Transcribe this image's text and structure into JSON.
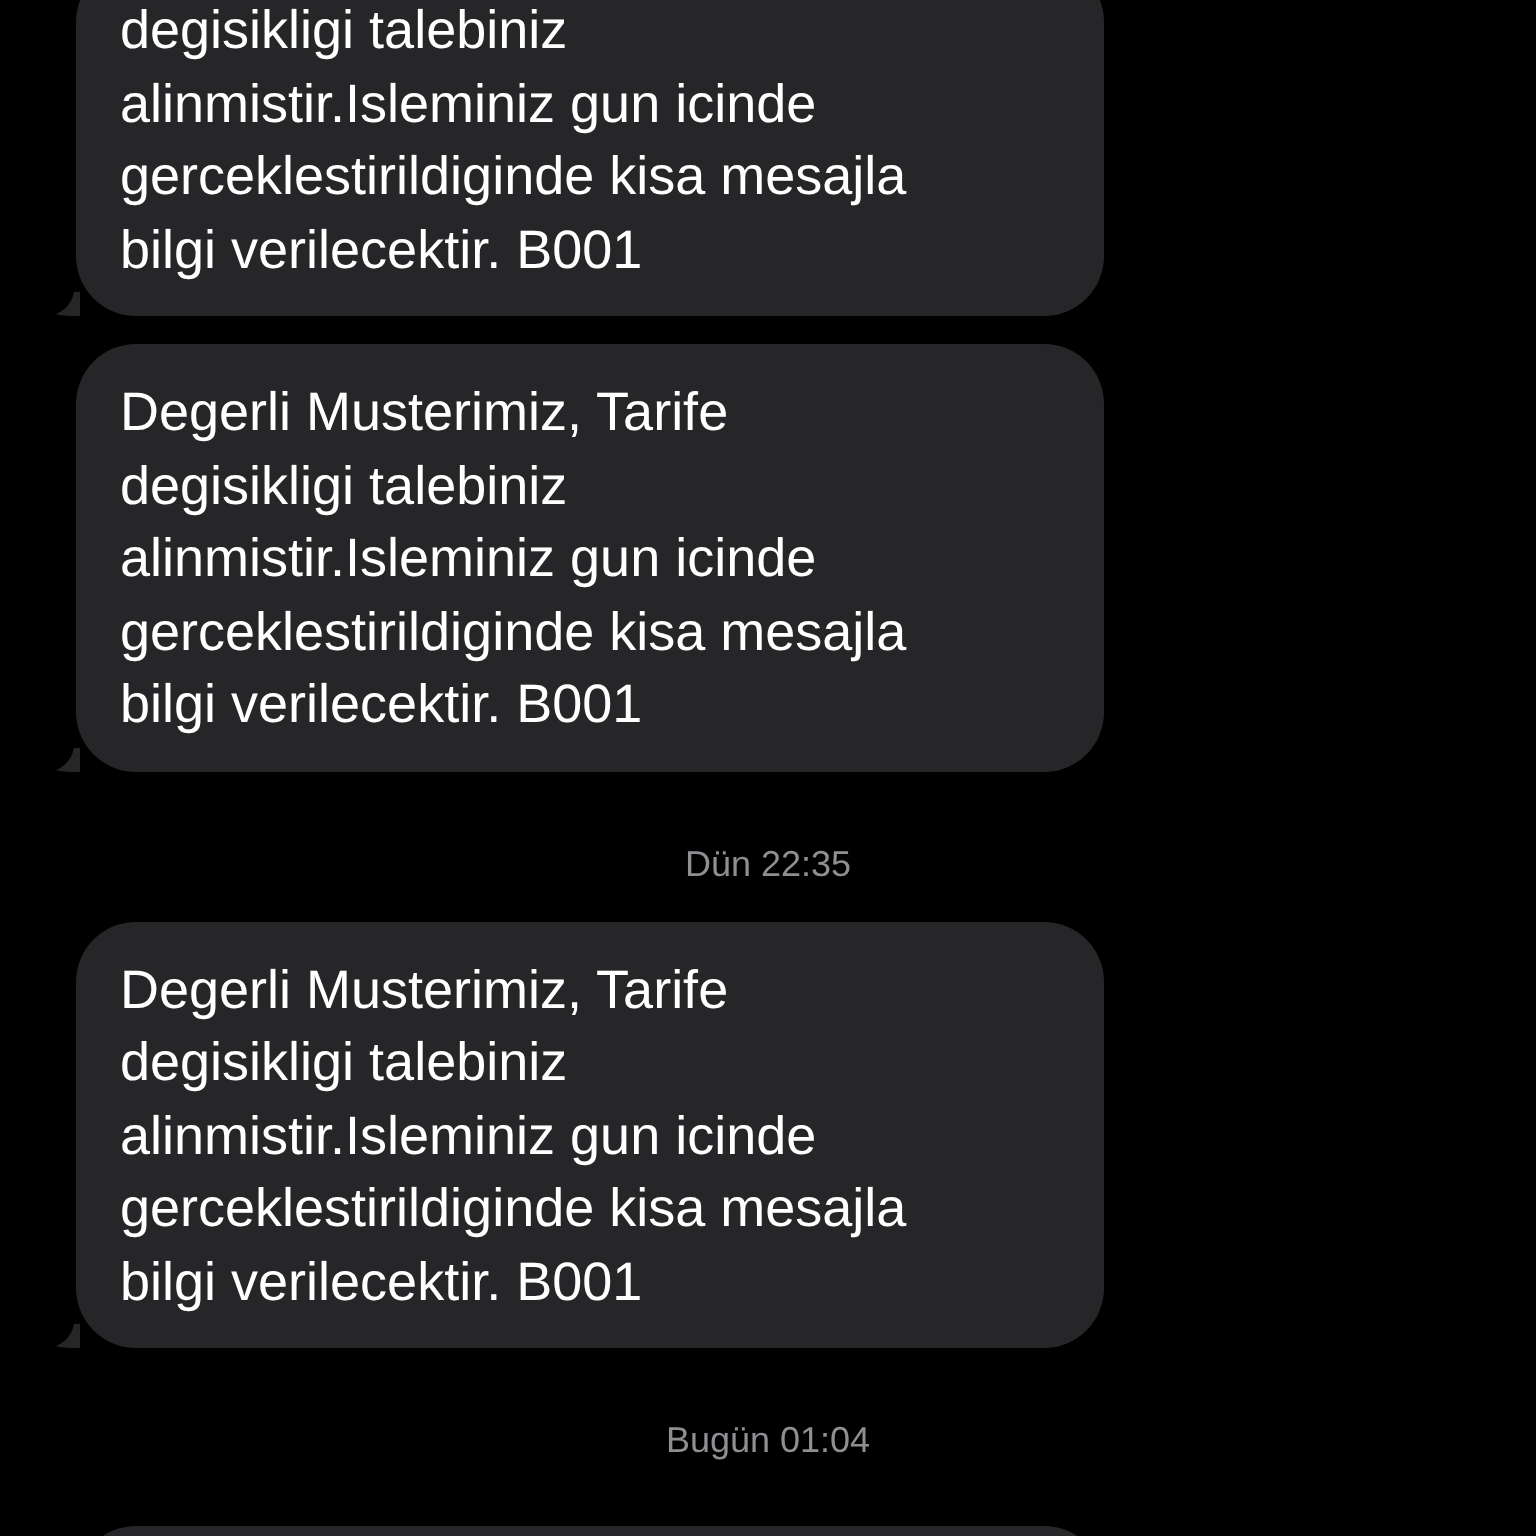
{
  "thread": [
    {
      "kind": "message",
      "text": "degisikligi talebiniz\nalinmistir.Isleminiz gun icinde\ngerceklestirildiginde kisa mesajla\nbilgi verilecektir. B001"
    },
    {
      "kind": "message",
      "text": "Degerli Musterimiz, Tarife\ndegisikligi talebiniz\nalinmistir.Isleminiz gun icinde\ngerceklestirildiginde kisa mesajla\nbilgi verilecektir. B001"
    },
    {
      "kind": "timestamp",
      "text": "Dün 22:35"
    },
    {
      "kind": "message",
      "text": "Degerli Musterimiz, Tarife\ndegisikligi talebiniz\nalinmistir.Isleminiz gun icinde\ngerceklestirildiginde kisa mesajla\nbilgi verilecektir. B001"
    },
    {
      "kind": "timestamp",
      "text": "Bugün 01:04"
    },
    {
      "kind": "message_cut"
    }
  ]
}
